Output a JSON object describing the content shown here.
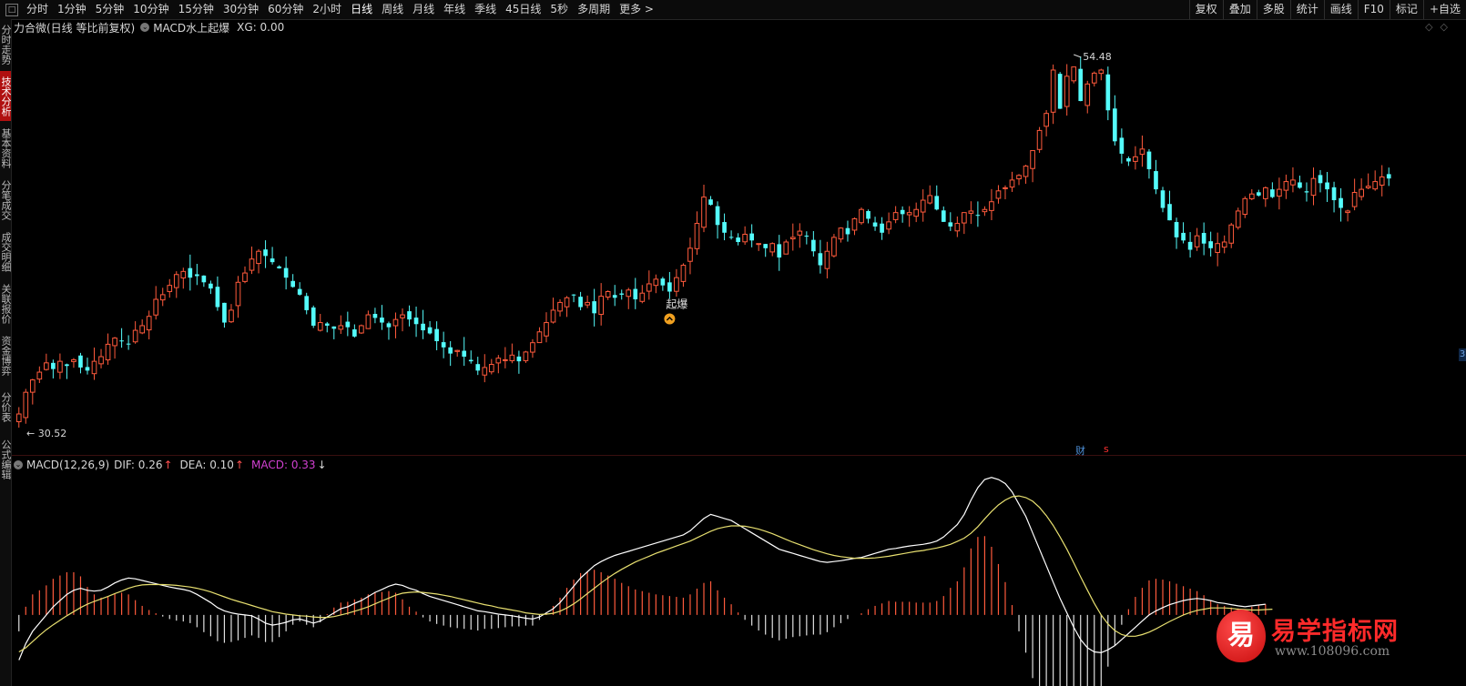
{
  "toolbar": {
    "periods": [
      "分时",
      "1分钟",
      "5分钟",
      "10分钟",
      "15分钟",
      "30分钟",
      "60分钟",
      "2小时",
      "日线",
      "周线",
      "月线",
      "年线",
      "季线",
      "45日线",
      "5秒",
      "多周期",
      "更多 >"
    ],
    "active_period": "日线",
    "tools": [
      "复权",
      "叠加",
      "多股",
      "统计",
      "画线",
      "F10",
      "标记",
      "+自选"
    ]
  },
  "sidebar": {
    "tabs": [
      {
        "label": "分时走势",
        "active": false
      },
      {
        "label": "技术分析",
        "active": true
      },
      {
        "label": "基本资料",
        "active": false
      },
      {
        "label": "分笔成交",
        "active": false
      },
      {
        "label": "成交明细",
        "active": false
      },
      {
        "label": "关联报价",
        "active": false
      },
      {
        "label": "资金博弈",
        "active": false
      },
      {
        "label": "分价表",
        "active": false
      },
      {
        "label": "公式编辑",
        "active": false
      }
    ]
  },
  "main_header": {
    "title": "力合微(日线 等比前复权)",
    "indicator": "MACD水上起爆",
    "xg_text": "XG: 0.00"
  },
  "macd_header": {
    "params": "MACD(12,26,9)",
    "dif_label": "DIF: 0.26",
    "dif_arrow": "↑",
    "dea_label": "DEA: 0.10",
    "dea_arrow": "↑",
    "macd_label": "MACD: 0.33",
    "macd_arrow": "↓"
  },
  "annotations": {
    "high_label": "54.48",
    "low_label": "30.52",
    "signal_text": "起爆",
    "cai_badge": "财",
    "s_badge": "s",
    "right_marker": "3"
  },
  "colors": {
    "up": "#ff5a3c",
    "down": "#54fcfc",
    "dif": "#ffffff",
    "dea": "#e8e070",
    "hist_pos": "#ff5a3c",
    "hist_neg": "#e0e0e0"
  },
  "watermark": {
    "logo_char": "易",
    "title": "易学指标网",
    "url": "www.108096.com"
  },
  "chart_data": {
    "type": "candlestick",
    "price_range": [
      30.52,
      54.48
    ],
    "high_value": 54.48,
    "low_value": 30.52,
    "signal_index": 95,
    "closes": [
      31.4,
      32.8,
      33.6,
      34.1,
      34.7,
      34.3,
      34.8,
      34.5,
      34.9,
      34.4,
      34.2,
      34.8,
      35.1,
      35.9,
      36.3,
      36.1,
      35.9,
      36.8,
      37.1,
      37.7,
      38.8,
      39.1,
      39.7,
      40.4,
      40.6,
      40.2,
      40.3,
      39.9,
      39.5,
      38.3,
      37.3,
      38.1,
      39.9,
      40.5,
      41.4,
      41.9,
      41.6,
      41.2,
      40.8,
      40.2,
      39.6,
      39.1,
      38.1,
      37.1,
      37.3,
      37.1,
      36.9,
      37.1,
      37.0,
      36.4,
      37.1,
      37.8,
      37.6,
      37.3,
      37.0,
      37.5,
      37.8,
      37.5,
      37.2,
      36.8,
      36.6,
      36.1,
      35.7,
      35.3,
      35.5,
      35.1,
      34.8,
      34.2,
      34.4,
      34.6,
      35.0,
      34.9,
      35.2,
      34.8,
      35.4,
      36.0,
      36.7,
      37.3,
      38.1,
      38.6,
      38.9,
      39.1,
      38.3,
      38.6,
      37.9,
      39.0,
      39.3,
      38.9,
      39.1,
      39.4,
      38.8,
      39.2,
      39.8,
      40.1,
      39.7,
      39.3,
      40.2,
      41.0,
      42.1,
      43.7,
      45.4,
      44.9,
      43.6,
      43.1,
      42.8,
      42.5,
      43.0,
      42.6,
      42.4,
      42.1,
      42.4,
      41.5,
      42.5,
      42.8,
      43.2,
      42.9,
      41.9,
      41.0,
      41.9,
      42.8,
      43.4,
      43.0,
      44.0,
      44.6,
      44.0,
      43.5,
      43.1,
      43.8,
      44.4,
      44.3,
      44.4,
      44.6,
      45.2,
      45.5,
      44.6,
      43.8,
      43.5,
      43.7,
      44.4,
      44.5,
      44.2,
      44.6,
      45.1,
      45.8,
      46.0,
      46.5,
      46.8,
      47.4,
      48.4,
      49.7,
      50.8,
      53.6,
      51.1,
      53.2,
      53.8,
      51.6,
      52.7,
      53.4,
      53.6,
      51.0,
      49.0,
      48.2,
      47.7,
      48.0,
      48.5,
      47.2,
      45.9,
      44.7,
      43.9,
      42.8,
      42.6,
      42.0,
      42.9,
      42.4,
      42.1,
      42.4,
      42.5,
      43.6,
      44.5,
      45.3,
      45.6,
      45.5,
      46.0,
      45.4,
      45.9,
      46.4,
      46.5,
      46.0,
      45.7,
      46.6,
      46.3,
      45.9,
      45.2,
      44.7,
      44.5,
      45.7,
      45.9,
      46.1,
      46.4,
      46.7,
      46.6
    ],
    "macd": {
      "dif": [
        -1.1,
        -0.7,
        -0.4,
        -0.2,
        0.0,
        0.2,
        0.35,
        0.5,
        0.6,
        0.65,
        0.6,
        0.58,
        0.6,
        0.68,
        0.78,
        0.85,
        0.9,
        0.88,
        0.84,
        0.8,
        0.76,
        0.72,
        0.68,
        0.65,
        0.62,
        0.58,
        0.5,
        0.4,
        0.3,
        0.18,
        0.1,
        0.05,
        0.02,
        0.0,
        -0.02,
        -0.1,
        -0.2,
        -0.25,
        -0.22,
        -0.18,
        -0.12,
        -0.1,
        -0.15,
        -0.2,
        -0.15,
        -0.05,
        0.05,
        0.15,
        0.2,
        0.28,
        0.35,
        0.45,
        0.55,
        0.62,
        0.7,
        0.75,
        0.72,
        0.65,
        0.6,
        0.52,
        0.45,
        0.4,
        0.35,
        0.3,
        0.25,
        0.2,
        0.15,
        0.1,
        0.08,
        0.05,
        0.02,
        0.0,
        -0.02,
        -0.05,
        -0.08,
        -0.1,
        -0.05,
        0.05,
        0.15,
        0.3,
        0.5,
        0.7,
        0.9,
        1.05,
        1.2,
        1.3,
        1.38,
        1.45,
        1.5,
        1.55,
        1.6,
        1.65,
        1.7,
        1.75,
        1.8,
        1.85,
        1.9,
        1.95,
        2.05,
        2.2,
        2.35,
        2.45,
        2.4,
        2.35,
        2.3,
        2.2,
        2.1,
        2.0,
        1.9,
        1.8,
        1.7,
        1.6,
        1.55,
        1.5,
        1.45,
        1.4,
        1.35,
        1.3,
        1.28,
        1.3,
        1.32,
        1.35,
        1.38,
        1.4,
        1.45,
        1.5,
        1.55,
        1.6,
        1.62,
        1.65,
        1.68,
        1.7,
        1.72,
        1.75,
        1.8,
        1.9,
        2.05,
        2.2,
        2.45,
        2.8,
        3.1,
        3.3,
        3.35,
        3.3,
        3.2,
        3.0,
        2.7,
        2.4,
        2.0,
        1.6,
        1.2,
        0.8,
        0.4,
        0.05,
        -0.3,
        -0.6,
        -0.8,
        -0.9,
        -0.92,
        -0.85,
        -0.75,
        -0.6,
        -0.45,
        -0.3,
        -0.15,
        0.0,
        0.1,
        0.18,
        0.25,
        0.3,
        0.35,
        0.38,
        0.4,
        0.38,
        0.35,
        0.3,
        0.28,
        0.25,
        0.22,
        0.2,
        0.22,
        0.24,
        0.26
      ],
      "dea": [
        -0.9,
        -0.8,
        -0.65,
        -0.5,
        -0.36,
        -0.24,
        -0.13,
        -0.02,
        0.08,
        0.18,
        0.26,
        0.33,
        0.39,
        0.45,
        0.52,
        0.58,
        0.65,
        0.7,
        0.73,
        0.74,
        0.74,
        0.74,
        0.73,
        0.72,
        0.7,
        0.68,
        0.65,
        0.61,
        0.56,
        0.5,
        0.44,
        0.38,
        0.33,
        0.28,
        0.23,
        0.18,
        0.13,
        0.08,
        0.05,
        0.02,
        0.0,
        -0.02,
        -0.03,
        -0.05,
        -0.06,
        -0.06,
        -0.04,
        0.0,
        0.04,
        0.09,
        0.14,
        0.2,
        0.27,
        0.34,
        0.41,
        0.48,
        0.53,
        0.55,
        0.56,
        0.55,
        0.53,
        0.51,
        0.48,
        0.45,
        0.41,
        0.37,
        0.33,
        0.29,
        0.25,
        0.22,
        0.18,
        0.15,
        0.12,
        0.09,
        0.05,
        0.03,
        0.01,
        0.02,
        0.04,
        0.09,
        0.17,
        0.27,
        0.39,
        0.52,
        0.65,
        0.78,
        0.9,
        1.01,
        1.11,
        1.2,
        1.29,
        1.36,
        1.43,
        1.5,
        1.56,
        1.62,
        1.68,
        1.74,
        1.8,
        1.88,
        1.96,
        2.04,
        2.1,
        2.14,
        2.17,
        2.17,
        2.16,
        2.13,
        2.09,
        2.04,
        1.98,
        1.91,
        1.84,
        1.77,
        1.71,
        1.65,
        1.59,
        1.54,
        1.49,
        1.45,
        1.42,
        1.4,
        1.38,
        1.38,
        1.38,
        1.39,
        1.41,
        1.43,
        1.46,
        1.49,
        1.52,
        1.55,
        1.57,
        1.6,
        1.63,
        1.67,
        1.72,
        1.79,
        1.87,
        1.99,
        2.15,
        2.34,
        2.52,
        2.68,
        2.8,
        2.88,
        2.9,
        2.86,
        2.77,
        2.62,
        2.42,
        2.18,
        1.9,
        1.6,
        1.27,
        0.93,
        0.6,
        0.28,
        0.0,
        -0.22,
        -0.38,
        -0.48,
        -0.52,
        -0.52,
        -0.48,
        -0.42,
        -0.34,
        -0.25,
        -0.16,
        -0.08,
        0.0,
        0.06,
        0.11,
        0.14,
        0.17,
        0.17,
        0.17,
        0.16,
        0.14,
        0.13,
        0.12,
        0.12,
        0.13,
        0.14
      ]
    }
  }
}
